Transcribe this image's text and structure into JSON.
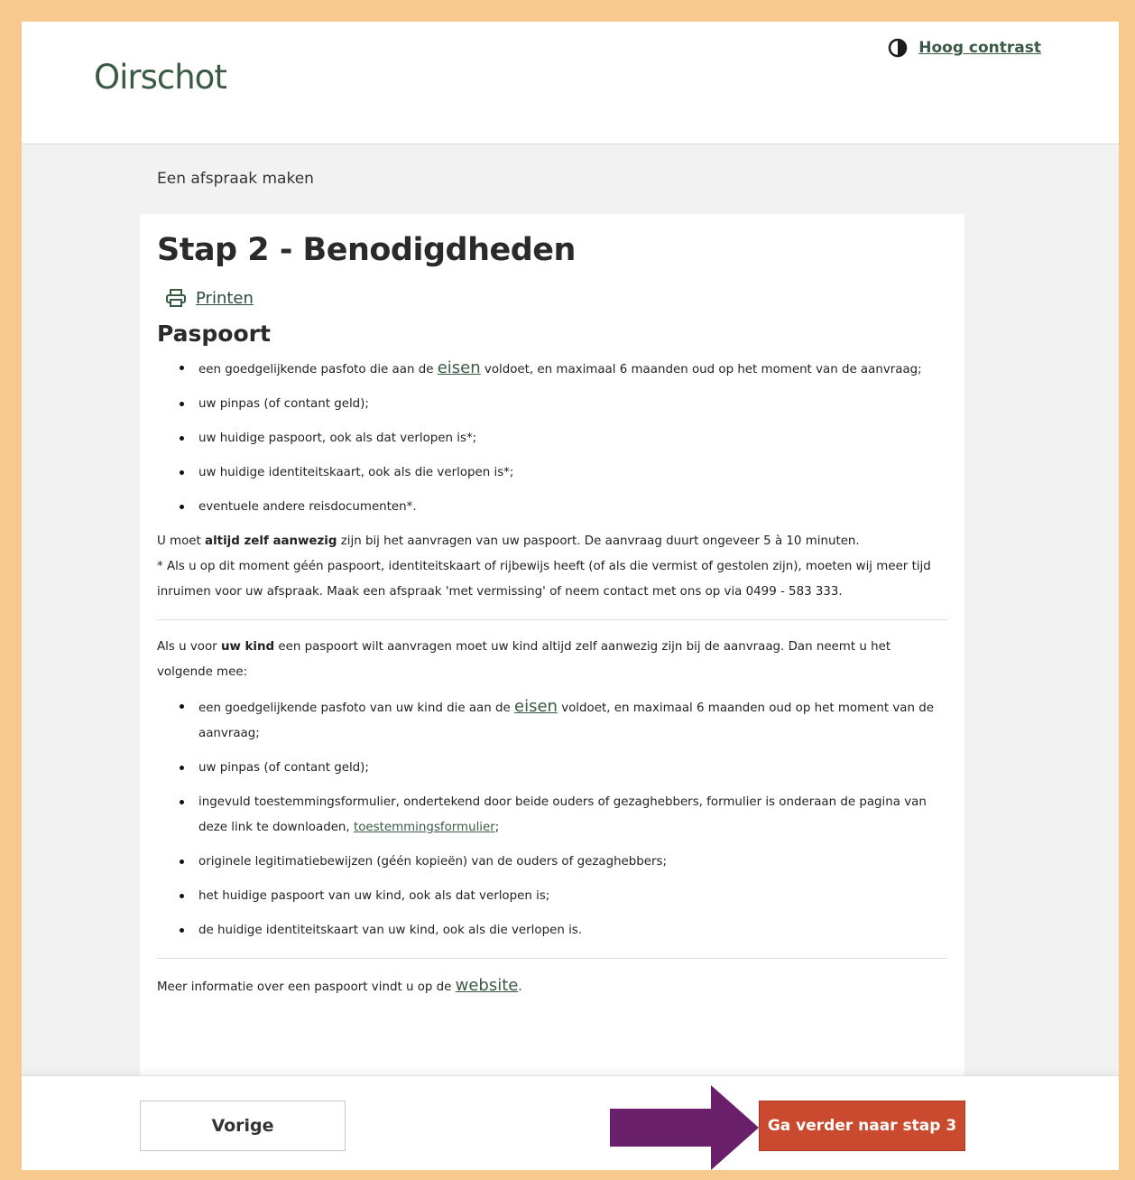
{
  "header": {
    "logo_text": "Oirschot",
    "contrast_label": "Hoog contrast"
  },
  "breadcrumb": "Een afspraak maken",
  "main": {
    "title": "Stap 2 - Benodigdheden",
    "print_label": "Printen",
    "section_title": "Paspoort",
    "list1": {
      "item1_pre": "een goedgelijkende pasfoto die aan de ",
      "item1_link": "eisen",
      "item1_post": " voldoet, en maximaal 6 maanden oud op het moment van de aanvraag;",
      "item2": "uw pinpas (of contant geld);",
      "item3": "uw huidige paspoort, ook als dat verlopen is*;",
      "item4": "uw huidige identiteitskaart, ook als die verlopen is*;",
      "item5": "eventuele andere reisdocumenten*."
    },
    "para1": {
      "pre": "U moet ",
      "bold": "altijd zelf aanwezig",
      "post": " zijn bij het aanvragen van uw paspoort. De aanvraag duurt ongeveer 5 à 10 minuten.",
      "line2": "* Als u op dit moment géén paspoort, identiteitskaart of rijbewijs heeft (of als die vermist of gestolen zijn), moeten wij meer tijd inruimen voor uw afspraak. Maak een afspraak 'met vermissing' of neem contact met ons op via 0499 - 583 333."
    },
    "para2": {
      "pre": "Als u voor ",
      "bold": "uw kind",
      "post": " een paspoort wilt aanvragen moet uw kind altijd zelf aanwezig zijn bij de aanvraag. Dan neemt u het volgende mee:"
    },
    "list2": {
      "item1_pre": "een goedgelijkende pasfoto van uw kind die aan de ",
      "item1_link": "eisen",
      "item1_post": " voldoet, en maximaal 6 maanden oud op het moment van de aanvraag;",
      "item2": "uw pinpas (of contant geld);",
      "item3_pre": "ingevuld toestemmingsformulier, ondertekend door beide ouders of gezaghebbers, formulier is onderaan de pagina van deze link te downloaden, ",
      "item3_link": "toestemmingsformulier",
      "item3_post": ";",
      "item4": "originele legitimatiebewijzen (géén kopieën) van de ouders of gezaghebbers;",
      "item5": "het huidige paspoort van uw kind, ook als dat verlopen is;",
      "item6": "de huidige identiteitskaart van uw kind, ook als die verlopen is."
    },
    "more_info": {
      "pre": "Meer informatie over een paspoort vindt u op de ",
      "link": "website",
      "post": "."
    }
  },
  "footer": {
    "prev_label": "Vorige",
    "next_label": "Ga verder naar stap 3"
  },
  "colors": {
    "frame_border": "#f7c98e",
    "brand_green": "#3b5a46",
    "next_button": "#c94a2e",
    "arrow": "#6a1f6b"
  }
}
